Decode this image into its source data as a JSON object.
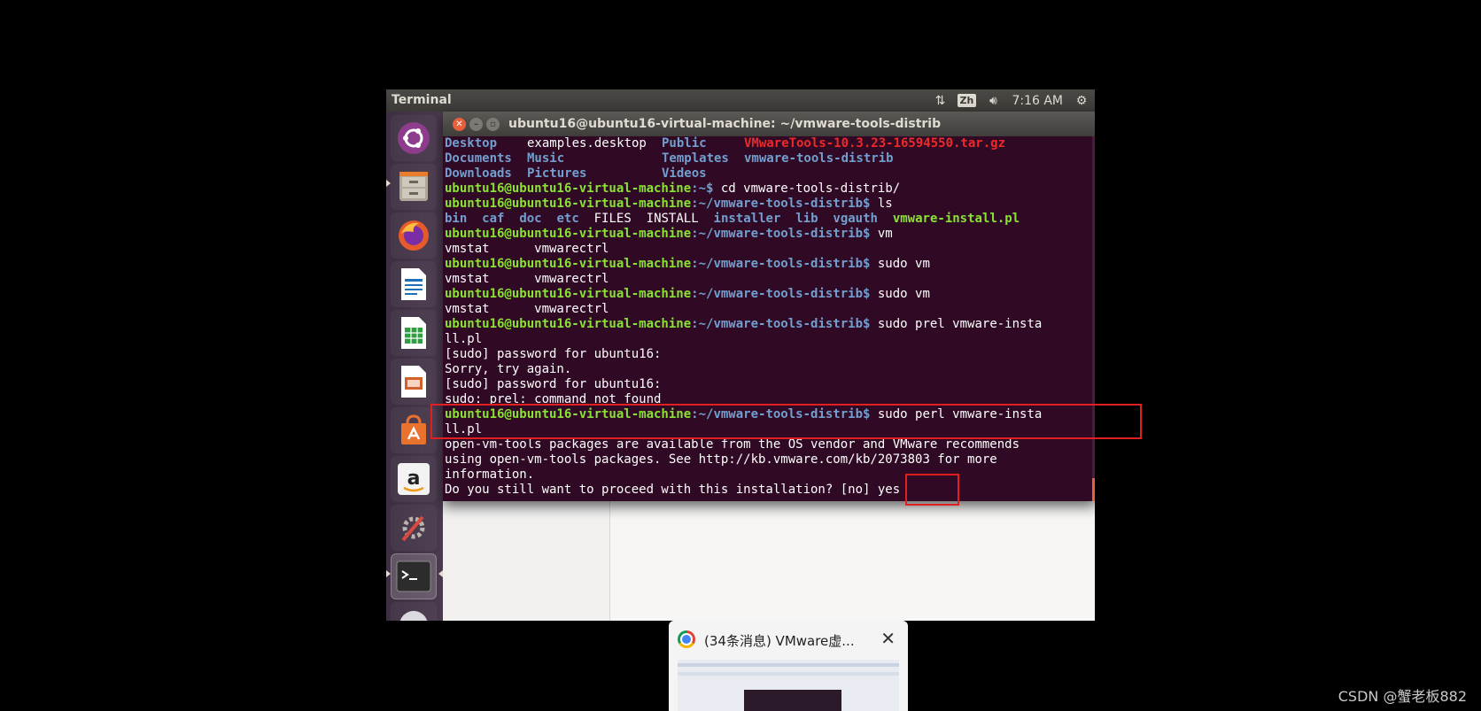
{
  "topbar": {
    "app_name": "Terminal",
    "input_method": "Zh",
    "clock": "7:16 AM",
    "icons": [
      "network-icon",
      "input-method-icon",
      "volume-icon",
      "settings-icon"
    ]
  },
  "launcher": {
    "items": [
      {
        "name": "ubuntu-dash",
        "icon": "ubuntu-logo-icon"
      },
      {
        "name": "files",
        "icon": "file-cabinet-icon"
      },
      {
        "name": "firefox",
        "icon": "firefox-icon"
      },
      {
        "name": "libreoffice-writer",
        "icon": "writer-icon"
      },
      {
        "name": "libreoffice-calc",
        "icon": "calc-icon"
      },
      {
        "name": "libreoffice-impress",
        "icon": "impress-icon"
      },
      {
        "name": "software-center",
        "icon": "shopping-bag-icon"
      },
      {
        "name": "amazon",
        "icon": "amazon-icon"
      },
      {
        "name": "system-settings",
        "icon": "tools-icon"
      },
      {
        "name": "terminal",
        "icon": "terminal-icon"
      }
    ]
  },
  "terminal": {
    "title": "ubuntu16@ubuntu16-virtual-machine: ~/vmware-tools-distrib",
    "prompt_user": "ubuntu16@ubuntu16-virtual-machine",
    "prompt_home": ":~$",
    "prompt_dir": ":~/vmware-tools-distrib$",
    "ls_home": {
      "c1": [
        "Desktop",
        "Documents",
        "Downloads"
      ],
      "c2": [
        "examples.desktop",
        "Music",
        "Pictures"
      ],
      "c3": [
        "Public",
        "Templates",
        "Videos"
      ],
      "c4": [
        "VMwareTools-10.3.23-16594550.tar.gz",
        "vmware-tools-distrib",
        ""
      ]
    },
    "cmd_cd": " cd vmware-tools-distrib/",
    "cmd_ls": " ls",
    "ls_distrib": {
      "bin": "bin",
      "caf": "caf",
      "doc": "doc",
      "etc": "etc",
      "files": "FILES",
      "install": "INSTALL",
      "installer": "installer",
      "lib": "lib",
      "vgauth": "vgauth",
      "vmware_install": "vmware-install.pl"
    },
    "cmd_vm": " vm",
    "completion": "vmstat      vmwarectrl",
    "cmd_sudo_vm": " sudo vm",
    "cmd_prel_a": " sudo prel vmware-insta",
    "cmd_wrap": "ll.pl",
    "sudo_prompt": "[sudo] password for ubuntu16:",
    "sorry": "Sorry, try again.",
    "not_found": "sudo: prel: command not found",
    "cmd_perl_a": " sudo perl vmware-insta",
    "msg1": "open-vm-tools packages are available from the OS vendor and VMware recommends",
    "msg2": "using open-vm-tools packages. See http://kb.vmware.com/kb/2073803 for more",
    "msg3": "information.",
    "question": "Do you still want to proceed with this installation? [no] ",
    "answer": "yes"
  },
  "preview": {
    "title": "(34条消息) VMware虚...",
    "close": "✕"
  },
  "watermark": "CSDN @蟹老板882"
}
